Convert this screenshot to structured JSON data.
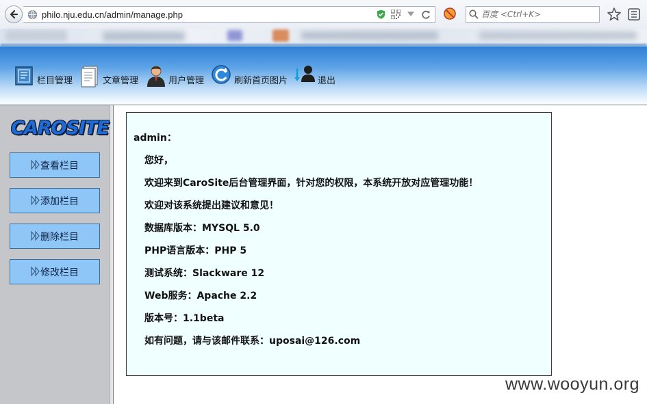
{
  "browser": {
    "url": "philo.nju.edu.cn/admin/manage.php",
    "search_placeholder": "百度 <Ctrl+K>"
  },
  "nav": {
    "items": [
      {
        "label": "栏目管理",
        "icon": "column-icon"
      },
      {
        "label": "文章管理",
        "icon": "article-icon"
      },
      {
        "label": "用户管理",
        "icon": "user-icon"
      },
      {
        "label": "刷新首页图片",
        "icon": "refresh-icon"
      },
      {
        "label": "退出",
        "icon": "logout-icon"
      }
    ]
  },
  "sidebar": {
    "logo": "CAROSITE",
    "buttons": [
      {
        "label": "查看栏目"
      },
      {
        "label": "添加栏目"
      },
      {
        "label": "删除栏目"
      },
      {
        "label": "修改栏目"
      }
    ]
  },
  "info": {
    "user": "admin：",
    "greeting": "您好，",
    "welcome": "欢迎来到CaroSite后台管理界面，针对您的权限，本系统开放对应管理功能！",
    "feedback": "欢迎对该系统提出建议和意见！",
    "db_version": "数据库版本：MYSQL 5.0",
    "php_version": "PHP语言版本：PHP 5",
    "test_system": "测试系统：Slackware 12",
    "web_service": "Web服务：Apache 2.2",
    "version": "版本号：1.1beta",
    "contact": "如有问题，请与该邮件联系：uposai@126.com"
  },
  "watermark": "www.wooyun.org",
  "colors": {
    "header_blue": "#2f7fd4",
    "sidebar_button": "#8ec6f7",
    "panel_bg": "#f0ffff",
    "sidebar_bg": "#c4c6c9"
  }
}
